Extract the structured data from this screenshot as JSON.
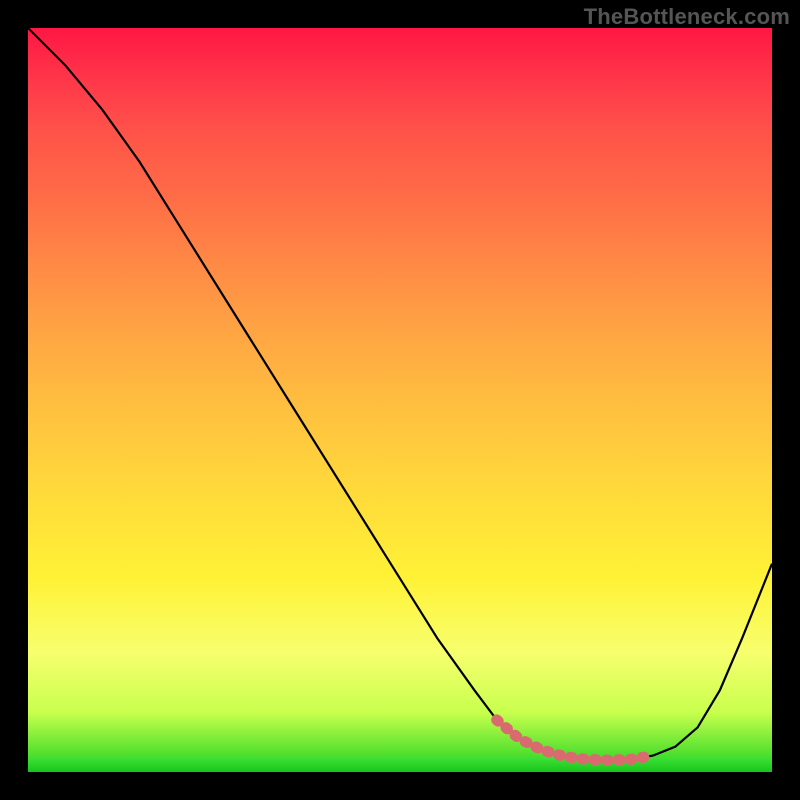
{
  "watermark": "TheBottleneck.com",
  "chart_data": {
    "type": "line",
    "title": "",
    "xlabel": "",
    "ylabel": "",
    "xlim": [
      0,
      100
    ],
    "ylim": [
      0,
      100
    ],
    "grid": false,
    "legend": false,
    "series": [
      {
        "name": "bottleneck-curve",
        "x": [
          0,
          5,
          10,
          15,
          20,
          25,
          30,
          35,
          40,
          45,
          50,
          55,
          60,
          63,
          66,
          69,
          72,
          75,
          78,
          81,
          84,
          87,
          90,
          93,
          96,
          100
        ],
        "y": [
          100,
          95,
          89,
          82,
          74,
          66,
          58,
          50,
          42,
          34,
          26,
          18,
          11,
          7,
          4.5,
          3,
          2.1,
          1.7,
          1.6,
          1.7,
          2.2,
          3.4,
          6,
          11,
          18,
          28
        ]
      }
    ],
    "highlight_range": {
      "x_start": 63,
      "x_end": 86
    },
    "colors": {
      "curve": "#000000",
      "highlight_stroke": "#d96a6f",
      "gradient_top": "#ff1744",
      "gradient_mid": "#ffe438",
      "gradient_bottom": "#17c51a"
    }
  }
}
